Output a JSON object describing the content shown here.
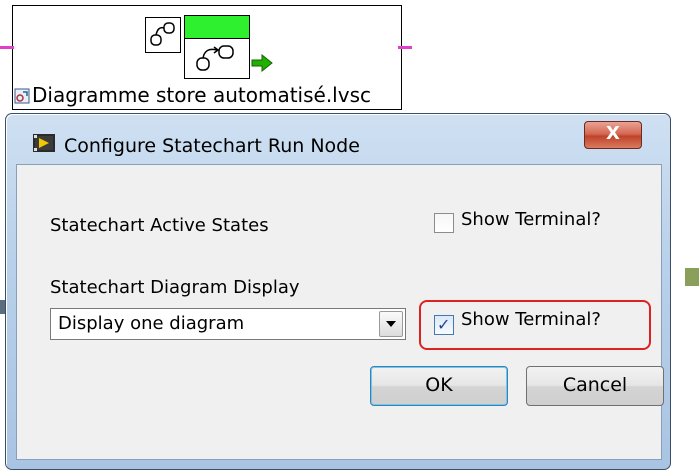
{
  "node": {
    "file_name": "Diagramme store automatisé.lvsc"
  },
  "dialog": {
    "title": "Configure Statechart Run Node",
    "close_label": "X",
    "active_states": {
      "label": "Statechart Active States",
      "checkbox_label": "Show Terminal?",
      "checked": false
    },
    "diagram_display": {
      "label": "Statechart Diagram Display",
      "selected": "Display one diagram",
      "checkbox_label": "Show Terminal?",
      "checked": true
    },
    "ok_label": "OK",
    "cancel_label": "Cancel"
  },
  "colors": {
    "highlight": "#dd2222",
    "node_header": "#2ef02e",
    "wire": "#e040c8",
    "run_arrow": "#22b000"
  },
  "icons": [
    "statechart-icon",
    "statechart-run-icon",
    "run-arrow-icon",
    "file-icon",
    "labview-app-icon",
    "close-icon",
    "dropdown-arrow-icon",
    "checkmark-icon"
  ]
}
